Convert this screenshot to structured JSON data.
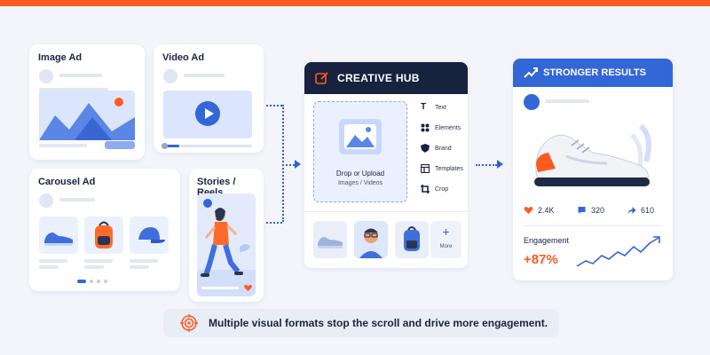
{
  "cards": {
    "image_ad": "Image Ad",
    "video_ad": "Video Ad",
    "carousel_ad": "Carousel Ad",
    "stories": "Stories / Reels"
  },
  "hub": {
    "title": "CREATIVE HUB",
    "upload_title": "Drop or Upload",
    "upload_sub": "Images / Videos",
    "tools": [
      "Text",
      "Elements",
      "Brand",
      "Templates",
      "Crop"
    ],
    "more": "More"
  },
  "results": {
    "title": "STRONGER RESULTS",
    "likes": "2.4K",
    "comments": "320",
    "shares": "610",
    "engagement_label": "Engagement",
    "engagement_value": "+87%"
  },
  "footer": {
    "text": "Multiple visual formats stop the scroll and drive more engagement."
  },
  "colors": {
    "accent_orange": "#ff5a1f",
    "primary_blue": "#3366d6",
    "dark_navy": "#17223f",
    "background": "#f3f5fb"
  },
  "icons": [
    "image-icon",
    "play-icon",
    "edit-icon",
    "text-tool-icon",
    "elements-icon",
    "brand-shield-icon",
    "templates-icon",
    "crop-icon",
    "trend-up-icon",
    "heart-icon",
    "comment-icon",
    "share-icon",
    "target-icon",
    "plus-icon"
  ]
}
